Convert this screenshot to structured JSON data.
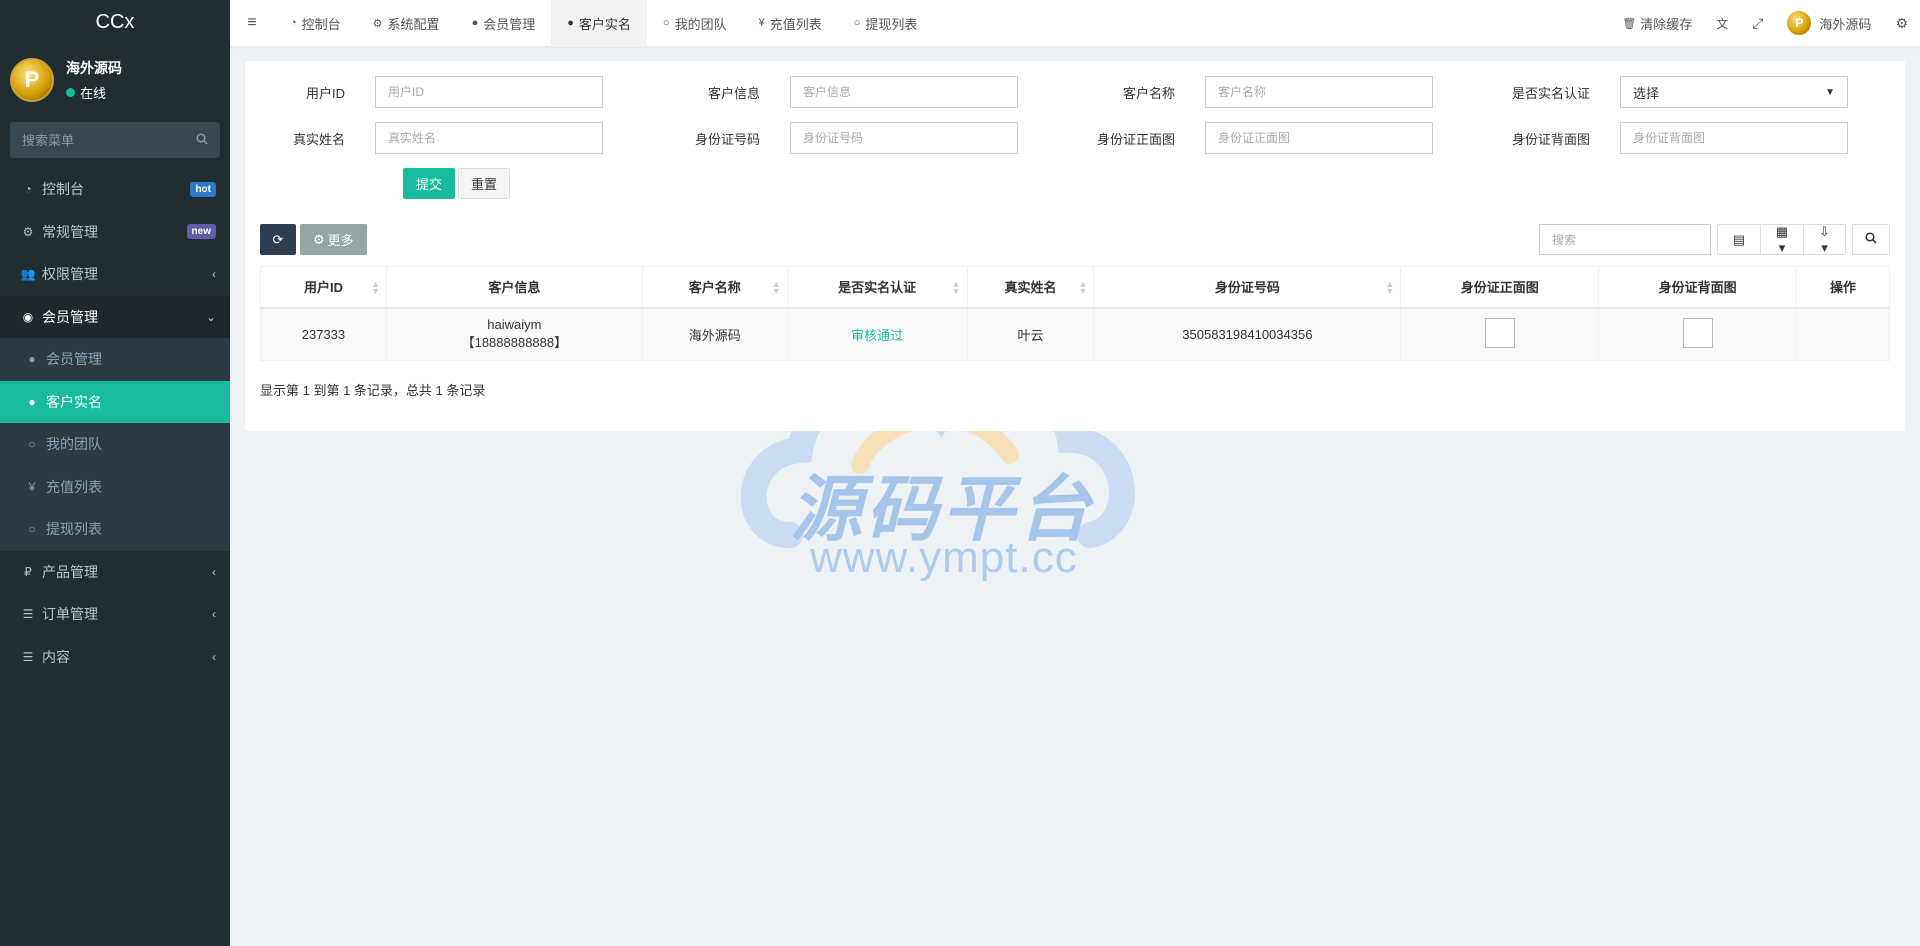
{
  "brand": "CCx",
  "user": {
    "name": "海外源码",
    "status": "在线",
    "avatar_letter": "P"
  },
  "sidebar": {
    "search_placeholder": "搜索菜单",
    "items": [
      {
        "label": "控制台",
        "icon": "dashboard-icon",
        "badge": "hot"
      },
      {
        "label": "常规管理",
        "icon": "cogs-icon",
        "badge": "new"
      },
      {
        "label": "权限管理",
        "icon": "users-icon"
      },
      {
        "label": "会员管理",
        "icon": "user-circle-icon"
      },
      {
        "label": "产品管理",
        "icon": "ruble-icon"
      },
      {
        "label": "订单管理",
        "icon": "list-icon"
      },
      {
        "label": "内容",
        "icon": "list-icon"
      }
    ],
    "submenu": [
      {
        "label": "会员管理",
        "icon": "user-icon"
      },
      {
        "label": "客户实名",
        "icon": "user-icon"
      },
      {
        "label": "我的团队",
        "icon": "circle-icon"
      },
      {
        "label": "充值列表",
        "icon": "yen-icon"
      },
      {
        "label": "提现列表",
        "icon": "circle-icon"
      }
    ]
  },
  "topnav": {
    "tabs": [
      {
        "label": "控制台",
        "icon": "dashboard-icon"
      },
      {
        "label": "系统配置",
        "icon": "gear-icon"
      },
      {
        "label": "会员管理",
        "icon": "user-icon"
      },
      {
        "label": "客户实名",
        "icon": "user-icon"
      },
      {
        "label": "我的团队",
        "icon": "circle-icon"
      },
      {
        "label": "充值列表",
        "icon": "yen-icon"
      },
      {
        "label": "提现列表",
        "icon": "circle-icon"
      }
    ],
    "clear_cache": "清除缓存",
    "username": "海外源码"
  },
  "form": {
    "fields": [
      {
        "label": "用户ID",
        "placeholder": "用户ID"
      },
      {
        "label": "客户信息",
        "placeholder": "客户信息"
      },
      {
        "label": "客户名称",
        "placeholder": "客户名称"
      },
      {
        "label": "是否实名认证",
        "value": "选择"
      },
      {
        "label": "真实姓名",
        "placeholder": "真实姓名"
      },
      {
        "label": "身份证号码",
        "placeholder": "身份证号码"
      },
      {
        "label": "身份证正面图",
        "placeholder": "身份证正面图"
      },
      {
        "label": "身份证背面图",
        "placeholder": "身份证背面图"
      }
    ],
    "submit": "提交",
    "reset": "重置"
  },
  "toolbar": {
    "more": "更多",
    "search_placeholder": "搜索"
  },
  "table": {
    "columns": [
      "用户ID",
      "客户信息",
      "客户名称",
      "是否实名认证",
      "真实姓名",
      "身份证号码",
      "身份证正面图",
      "身份证背面图",
      "操作"
    ],
    "rows": [
      {
        "id": "237333",
        "info_line1": "haiwaiym",
        "info_line2": "【18888888888】",
        "name": "海外源码",
        "verified": "审核通过",
        "real_name": "叶云",
        "id_number": "350583198410034356"
      }
    ]
  },
  "pagination": "显示第 1 到第 1 条记录，总共 1 条记录",
  "watermark": {
    "text": "源码平台",
    "url": "www.ympt.cc"
  },
  "colors": {
    "accent": "#18bc9c",
    "sidebar": "#222d32",
    "dark_button": "#2c3e50"
  }
}
